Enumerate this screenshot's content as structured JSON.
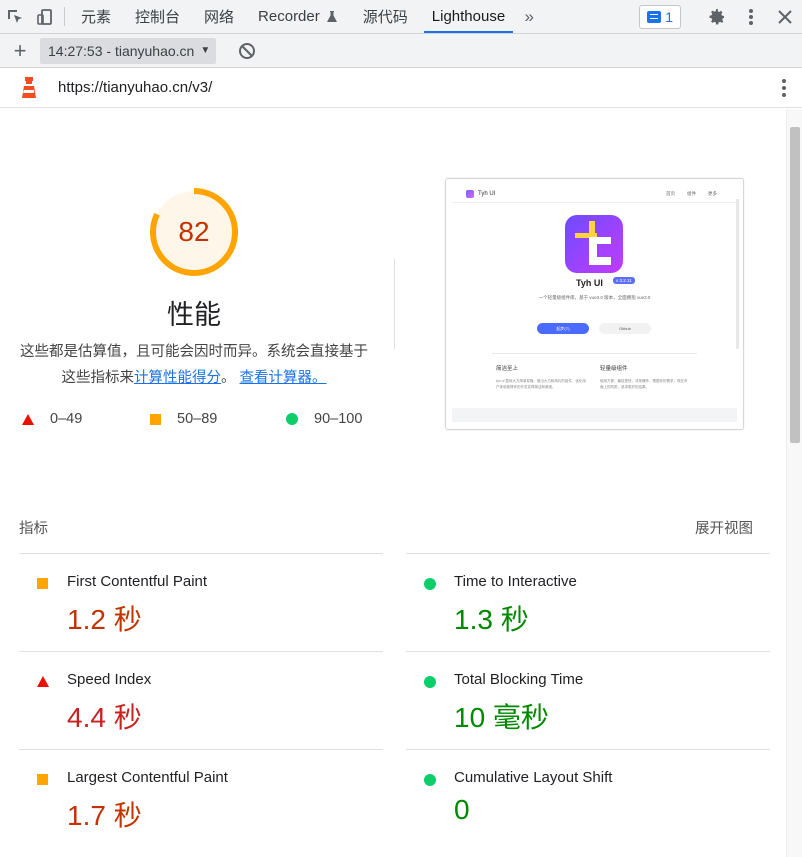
{
  "devtools": {
    "tabs": [
      {
        "label": "元素"
      },
      {
        "label": "控制台"
      },
      {
        "label": "网络"
      },
      {
        "label": "Recorder"
      },
      {
        "label": "源代码"
      },
      {
        "label": "Lighthouse"
      }
    ],
    "issues_count": "1"
  },
  "toolbar": {
    "report_label": "14:27:53 - tianyuhao.cn"
  },
  "url_bar": {
    "url": "https://tianyuhao.cn/v3/"
  },
  "category": {
    "score": "82",
    "score_value": 82,
    "title": "性能",
    "description_prefix": "这些都是估算值，且可能会因时而异。系统会直接基于这些指标来",
    "calc_link": "计算性能得分",
    "desc_sep": "。",
    "calculator_link": "查看计算器。"
  },
  "legend": {
    "fail_range": "0–49",
    "average_range": "50–89",
    "pass_range": "90–100"
  },
  "screenshot": {
    "brand": "Tyh UI",
    "nav": [
      "首页",
      "组件",
      "更多"
    ],
    "title": "Tyh UI",
    "version": "v 3.2.11",
    "tagline": "一个轻量级组件库，基于 vue3.0 版本，全面拥抱 vue3.0",
    "btn_primary": "起步(T)",
    "btn_secondary": "Github",
    "feature1_title": "简洁至上",
    "feature1_desc": "tyh ui 整体大方简单易懂，做出大方和简约的组件，优化用户体验使得你的开发变得简洁和美观。",
    "feature2_title": "轻量级组件",
    "feature2_desc": "使用方便，最轻更快，非常爆炸，根据你的需求，现在市面上的同类，追求更好的结果。"
  },
  "metrics": {
    "header": "指标",
    "toggle": "展开视图",
    "left": [
      {
        "name": "First Contentful Paint",
        "value": "1.2 秒",
        "status": "average"
      },
      {
        "name": "Speed Index",
        "value": "4.4 秒",
        "status": "fail"
      },
      {
        "name": "Largest Contentful Paint",
        "value": "1.7 秒",
        "status": "average"
      }
    ],
    "right": [
      {
        "name": "Time to Interactive",
        "value": "1.3 秒",
        "status": "pass"
      },
      {
        "name": "Total Blocking Time",
        "value": "10 毫秒",
        "status": "pass"
      },
      {
        "name": "Cumulative Layout Shift",
        "value": "0",
        "status": "pass"
      }
    ]
  },
  "colors": {
    "fail": "#eb0f00",
    "average": "#ffa400",
    "pass": "#0cce6b",
    "accent": "#1a73e8"
  }
}
